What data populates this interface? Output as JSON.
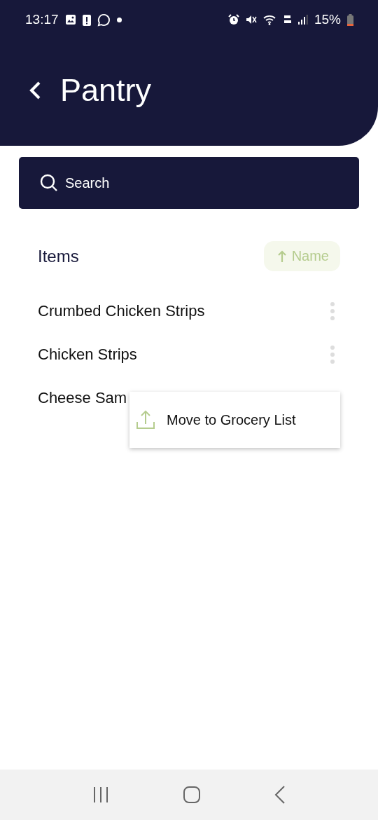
{
  "status_bar": {
    "time": "13:17",
    "battery": "15%"
  },
  "header": {
    "title": "Pantry"
  },
  "search": {
    "placeholder": "Search"
  },
  "list": {
    "title": "Items",
    "sort": {
      "label": "Name"
    },
    "items": [
      {
        "name": "Crumbed Chicken Strips",
        "more_button": true
      },
      {
        "name": "Chicken Strips",
        "more_button": true
      },
      {
        "name": "Cheese Sam",
        "more_button": false
      }
    ]
  },
  "popup_menu": {
    "items": [
      {
        "label": "Move to Grocery List"
      }
    ]
  }
}
